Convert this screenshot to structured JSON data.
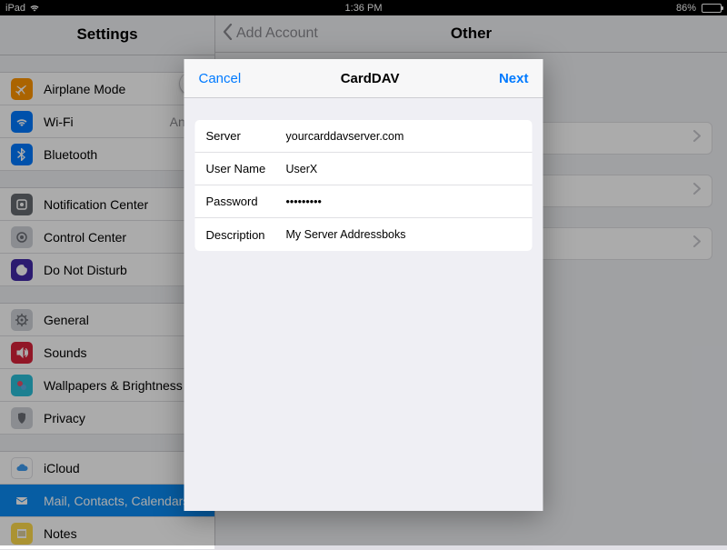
{
  "status": {
    "device": "iPad",
    "time": "1:36 PM",
    "battery_pct": "86%"
  },
  "sidebar": {
    "title": "Settings",
    "groups": [
      [
        {
          "icon": "airplane",
          "label": "Airplane Mode",
          "detail": "",
          "toggle": true
        },
        {
          "icon": "wifi",
          "label": "Wi-Fi",
          "detail": "Andre"
        },
        {
          "icon": "bt",
          "label": "Bluetooth",
          "detail": ""
        }
      ],
      [
        {
          "icon": "notif",
          "label": "Notification Center",
          "detail": ""
        },
        {
          "icon": "control",
          "label": "Control Center",
          "detail": ""
        },
        {
          "icon": "dnd",
          "label": "Do Not Disturb",
          "detail": ""
        }
      ],
      [
        {
          "icon": "general",
          "label": "General",
          "detail": ""
        },
        {
          "icon": "sounds",
          "label": "Sounds",
          "detail": ""
        },
        {
          "icon": "wall",
          "label": "Wallpapers & Brightness",
          "detail": ""
        },
        {
          "icon": "privacy",
          "label": "Privacy",
          "detail": ""
        }
      ],
      [
        {
          "icon": "icloud",
          "label": "iCloud",
          "detail": ""
        },
        {
          "icon": "mail",
          "label": "Mail, Contacts, Calendars",
          "detail": "",
          "selected": true
        },
        {
          "icon": "notes",
          "label": "Notes",
          "detail": ""
        }
      ]
    ]
  },
  "content": {
    "back": "Add Account",
    "title": "Other"
  },
  "modal": {
    "cancel": "Cancel",
    "title": "CardDAV",
    "next": "Next",
    "fields": {
      "server_label": "Server",
      "server_value": "yourcarddavserver.com",
      "username_label": "User Name",
      "username_value": "UserX",
      "password_label": "Password",
      "password_value": "secretpwd",
      "description_label": "Description",
      "description_value": "My Server Addressboks"
    }
  }
}
